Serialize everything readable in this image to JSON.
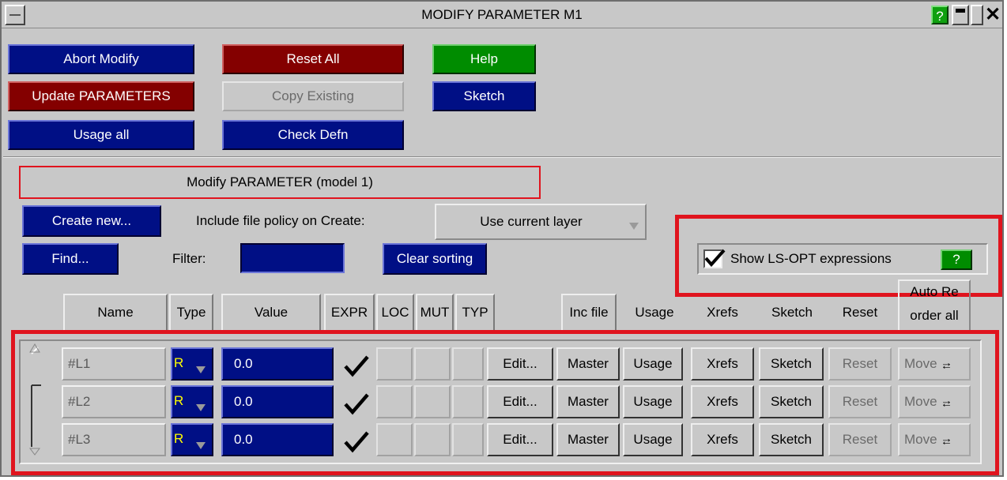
{
  "window": {
    "title": "MODIFY PARAMETER M1",
    "help_glyph": "?",
    "minimize_glyph": "▬",
    "close_glyph": "✕"
  },
  "actions": {
    "abort_modify": "Abort Modify",
    "reset_all": "Reset All",
    "help": "Help",
    "update_parameters": "Update PARAMETERS",
    "copy_existing": "Copy Existing",
    "sketch": "Sketch",
    "usage_all": "Usage all",
    "check_defn": "Check Defn"
  },
  "panel": {
    "heading": "Modify PARAMETER (model 1)",
    "create_new": "Create new...",
    "include_policy_label": "Include file policy on Create:",
    "include_policy_value": "Use current layer",
    "find": "Find...",
    "filter_label": "Filter:",
    "filter_value": "",
    "clear_sorting": "Clear sorting",
    "show_lsopt_label": "Show LS-OPT expressions",
    "show_lsopt_checked": true,
    "show_lsopt_help": "?"
  },
  "table": {
    "headers": {
      "name": "Name",
      "type": "Type",
      "value": "Value",
      "expr": "EXPR",
      "loc": "LOC",
      "mut": "MUT",
      "typ": "TYP",
      "inc_file": "Inc file",
      "usage": "Usage",
      "xrefs": "Xrefs",
      "sketch": "Sketch",
      "reset": "Reset",
      "auto_reorder_line1": "Auto Re",
      "auto_reorder_line2": "order all"
    },
    "rows": [
      {
        "name": "#L1",
        "type": "R",
        "value": "0.0",
        "expr": true,
        "edit": "Edit...",
        "inc_file": "Master",
        "usage": "Usage",
        "xrefs": "Xrefs",
        "sketch": "Sketch",
        "reset": "Reset",
        "move": "Move",
        "move_arrows": "↑↓"
      },
      {
        "name": "#L2",
        "type": "R",
        "value": "0.0",
        "expr": true,
        "edit": "Edit...",
        "inc_file": "Master",
        "usage": "Usage",
        "xrefs": "Xrefs",
        "sketch": "Sketch",
        "reset": "Reset",
        "move": "Move",
        "move_arrows": "↑↓"
      },
      {
        "name": "#L3",
        "type": "R",
        "value": "0.0",
        "expr": true,
        "edit": "Edit...",
        "inc_file": "Master",
        "usage": "Usage",
        "xrefs": "Xrefs",
        "sketch": "Sketch",
        "reset": "Reset",
        "move": "Move",
        "move_arrows": "↑↓"
      }
    ]
  },
  "colors": {
    "blue_button": "#000f85",
    "red_button": "#840000",
    "green_button": "#008c00",
    "highlight_frame": "#e0141e",
    "panel_bg": "#c8c8c8",
    "type_text": "#ffff00"
  }
}
